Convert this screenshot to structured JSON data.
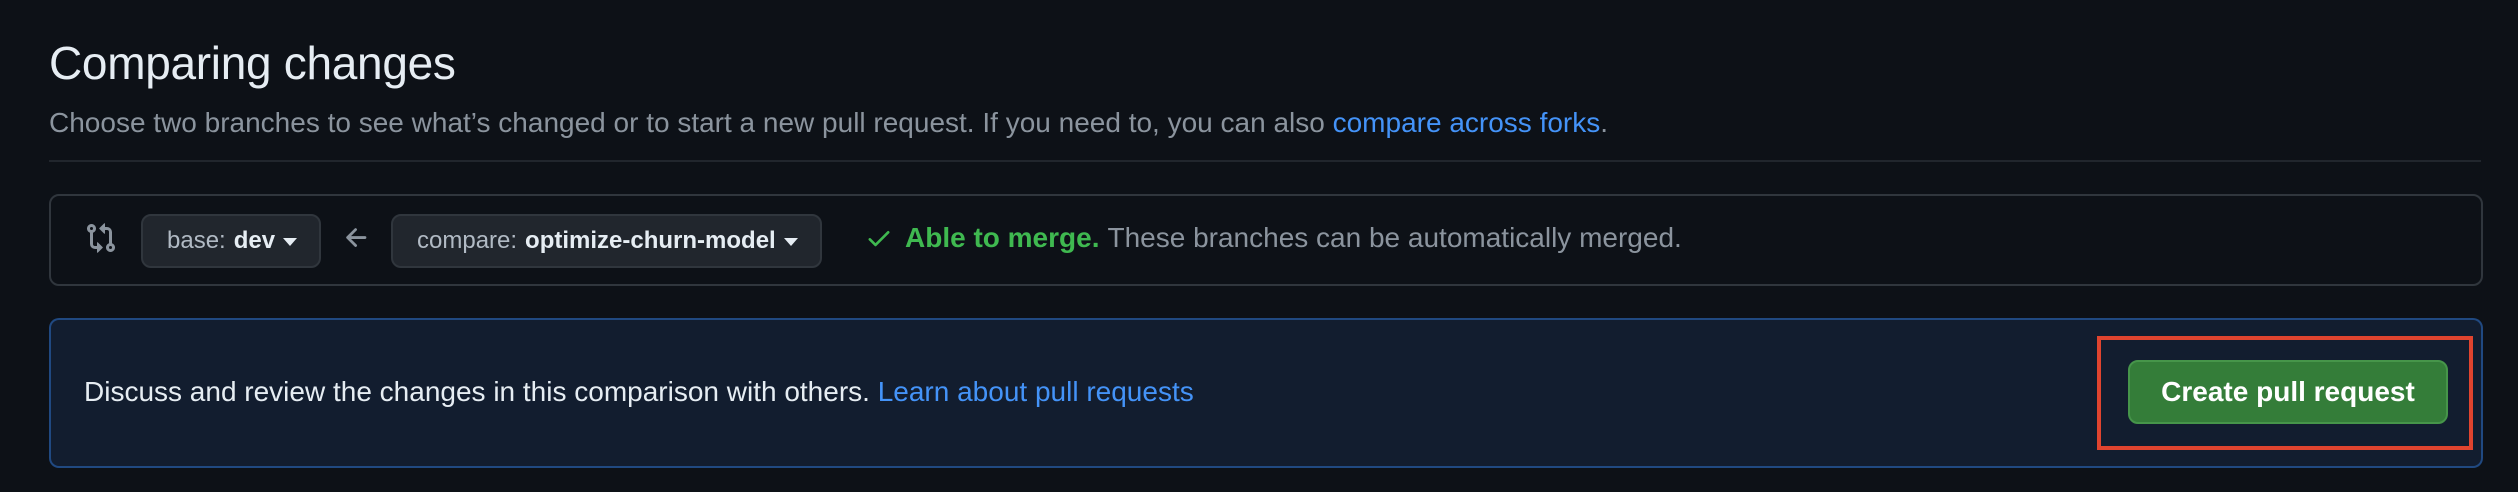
{
  "header": {
    "title": "Comparing changes",
    "subtitle_text": "Choose two branches to see what’s changed or to start a new pull request. If you need to, you can also ",
    "subtitle_link": "compare across forks",
    "subtitle_end": "."
  },
  "range": {
    "base_prefix": "base:",
    "base_branch": "dev",
    "compare_prefix": "compare:",
    "compare_branch": "optimize-churn-model",
    "merge_status": "Able to merge.",
    "merge_message": "These branches can be automatically merged."
  },
  "blankslate": {
    "text": "Discuss and review the changes in this comparison with others. ",
    "link": "Learn about pull requests",
    "create_button": "Create pull request"
  },
  "icons": {
    "range": "git-compare-icon",
    "arrow": "arrow-left-icon",
    "check": "check-icon",
    "caret": "triangle-down-icon"
  },
  "colors": {
    "background": "#0d1117",
    "link": "#4493f8",
    "success": "#3fb950",
    "button_green": "#347d39",
    "highlight_red": "#e0442f"
  }
}
